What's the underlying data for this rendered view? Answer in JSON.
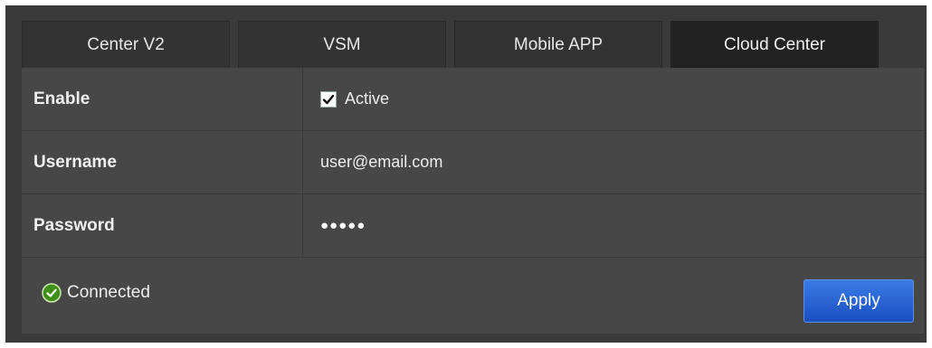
{
  "tabs": [
    {
      "label": "Center V2",
      "active": false
    },
    {
      "label": "VSM",
      "active": false
    },
    {
      "label": "Mobile APP",
      "active": false
    },
    {
      "label": "Cloud Center",
      "active": true
    }
  ],
  "form": {
    "enable": {
      "label": "Enable",
      "checkbox_label": "Active",
      "checked": true
    },
    "username": {
      "label": "Username",
      "value": "user@email.com"
    },
    "password": {
      "label": "Password",
      "value": "●●●●●"
    }
  },
  "status": {
    "text": "Connected",
    "icon": "check-circle-icon",
    "color": "#4a9a1a"
  },
  "apply_label": "Apply",
  "colors": {
    "accent": "#2a62d6",
    "background": "#3a3a3a",
    "panel": "#474747"
  }
}
